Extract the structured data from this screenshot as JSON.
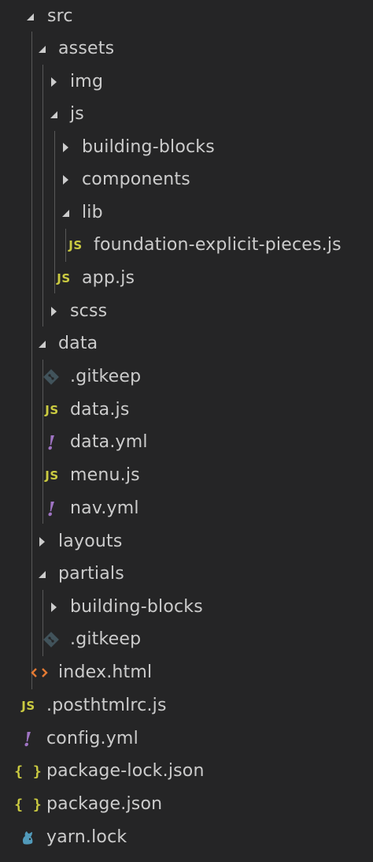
{
  "tree": {
    "src": "src",
    "assets": "assets",
    "img": "img",
    "js": "js",
    "building_blocks": "building-blocks",
    "components": "components",
    "lib": "lib",
    "foundation_explicit_pieces": "foundation-explicit-pieces.js",
    "app_js": "app.js",
    "scss": "scss",
    "data": "data",
    "data_gitkeep": ".gitkeep",
    "data_js": "data.js",
    "data_yml": "data.yml",
    "menu_js": "menu.js",
    "nav_yml": "nav.yml",
    "layouts": "layouts",
    "partials": "partials",
    "partials_building_blocks": "building-blocks",
    "partials_gitkeep": ".gitkeep",
    "index_html": "index.html",
    "posthtmlrc": ".posthtmlrc.js",
    "config_yml": "config.yml",
    "package_lock": "package-lock.json",
    "package_json": "package.json",
    "yarn_lock": "yarn.lock"
  },
  "icon_glyphs": {
    "js": "JS",
    "yml": "!",
    "json": "{ }",
    "html": "<>"
  },
  "colors": {
    "background": "#252526",
    "text": "#cccccc",
    "js": "#cbcb41",
    "yml": "#a074c4",
    "html": "#e37933",
    "git": "#41535b",
    "yarn": "#519aba",
    "guide": "#585858"
  }
}
